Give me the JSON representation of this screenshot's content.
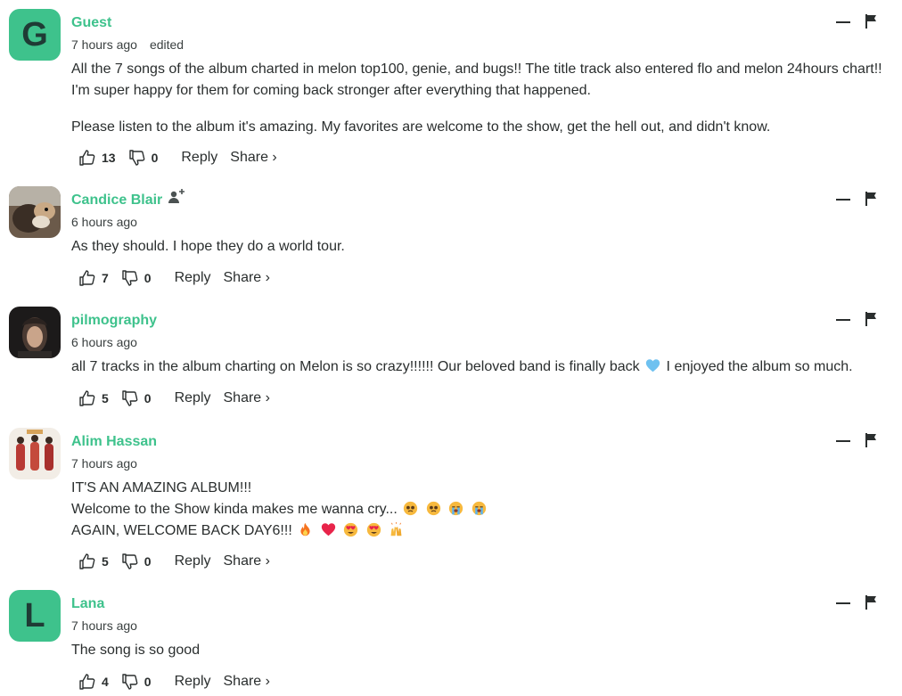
{
  "comments": [
    {
      "name": "Guest",
      "avatar_letter": "G",
      "time": "7 hours ago",
      "edited": "edited",
      "paragraphs": [
        "All the 7 songs of the album charted in melon top100, genie, and bugs!! The title track also entered flo and melon 24hours chart!! I'm super happy for them for coming back stronger after everything that happened.",
        "Please listen to the album it's amazing. My favorites are welcome to the show, get the hell out, and didn't know."
      ],
      "upvotes": "13",
      "downvotes": "0",
      "reply_label": "Reply",
      "share_label": "Share ›"
    },
    {
      "name": "Candice Blair",
      "time": "6 hours ago",
      "text": "As they should. I hope they do a world tour.",
      "upvotes": "7",
      "downvotes": "0",
      "reply_label": "Reply",
      "share_label": "Share ›"
    },
    {
      "name": "pilmography",
      "time": "6 hours ago",
      "text_before": "all 7 tracks in the album charting on Melon is so crazy!!!!!! Our beloved band is finally back",
      "text_after": "I enjoyed the album so much.",
      "upvotes": "5",
      "downvotes": "0",
      "reply_label": "Reply",
      "share_label": "Share ›"
    },
    {
      "name": "Alim Hassan",
      "time": "7 hours ago",
      "line1": "IT'S AN AMAZING ALBUM!!!",
      "line2": "Welcome to the Show kinda makes me wanna cry...",
      "line3": "AGAIN, WELCOME BACK DAY6!!!",
      "upvotes": "5",
      "downvotes": "0",
      "reply_label": "Reply",
      "share_label": "Share ›"
    },
    {
      "name": "Lana",
      "avatar_letter": "L",
      "time": "7 hours ago",
      "text": "The song is so good",
      "upvotes": "4",
      "downvotes": "0",
      "reply_label": "Reply",
      "share_label": "Share ›"
    }
  ],
  "colors": {
    "accent": "#3ec28c",
    "text": "#2a2e2e"
  }
}
